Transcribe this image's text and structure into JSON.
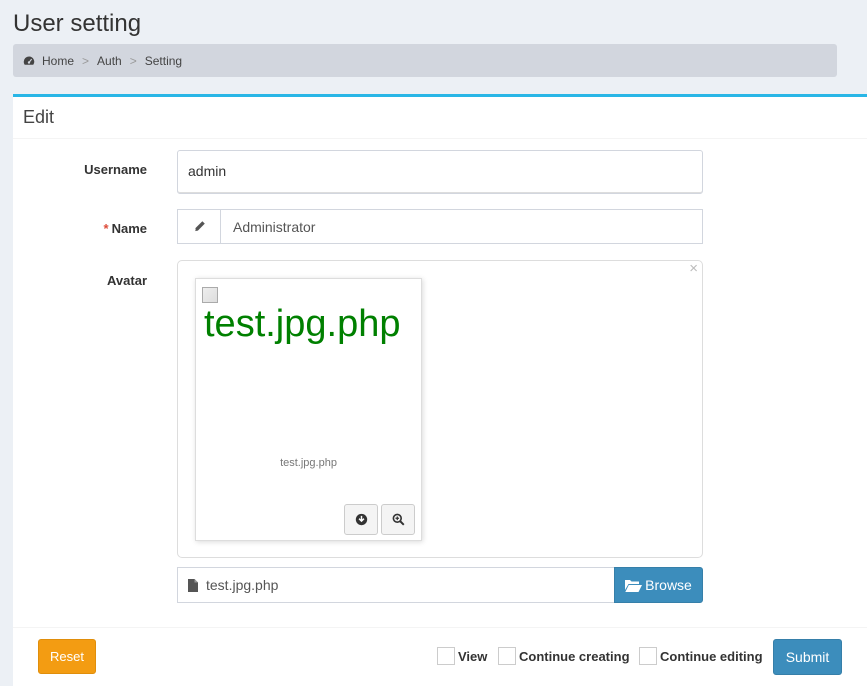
{
  "page": {
    "title": "User setting"
  },
  "breadcrumb": {
    "home": "Home",
    "auth": "Auth",
    "setting": "Setting",
    "separator": ">"
  },
  "form": {
    "heading": "Edit",
    "username": {
      "label": "Username",
      "value": "admin"
    },
    "name": {
      "label": "Name",
      "required_mark": "*",
      "value": "Administrator"
    },
    "avatar": {
      "label": "Avatar",
      "preview_alt_text": "test.jpg.php",
      "caption": "test.jpg.php",
      "close_symbol": "×",
      "file_name": "test.jpg.php",
      "browse_label": "Browse"
    }
  },
  "footer": {
    "reset_label": "Reset",
    "view_label": "View",
    "continue_creating_label": "Continue creating",
    "continue_editing_label": "Continue editing",
    "submit_label": "Submit"
  },
  "colors": {
    "primary": "#3c8dbc",
    "warning": "#f39c12",
    "box_top_border": "#29b6e6",
    "preview_text": "#008000",
    "required": "#dd4b39"
  }
}
